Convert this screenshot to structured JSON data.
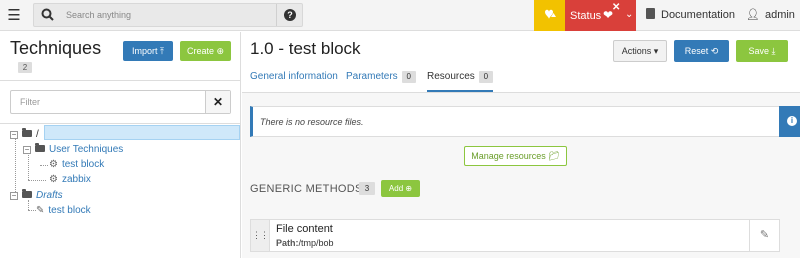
{
  "topbar": {
    "search_placeholder": "Search anything",
    "status_label": "Status",
    "documentation_label": "Documentation",
    "user_label": "admin",
    "colors": {
      "warning": "#f2c200",
      "status": "#d9403a"
    }
  },
  "left": {
    "title": "Techniques",
    "count": "2",
    "import_label": "Import",
    "create_label": "Create",
    "filter_placeholder": "Filter",
    "tree": {
      "root": "/",
      "category": "User Techniques",
      "items": [
        "test block",
        "zabbix"
      ],
      "drafts_label": "Drafts",
      "draft_items": [
        "test block"
      ]
    }
  },
  "main": {
    "title": "1.0 - test block",
    "actions_label": "Actions",
    "reset_label": "Reset",
    "save_label": "Save",
    "tabs": [
      {
        "label": "General information"
      },
      {
        "label": "Parameters",
        "count": "0"
      },
      {
        "label": "Resources",
        "count": "0"
      }
    ],
    "info_text": "There is no resource files.",
    "manage_resources_label": "Manage resources",
    "generic_methods_label": "GENERIC METHODS",
    "generic_methods_count": "3",
    "add_label": "Add",
    "method": {
      "name": "File content",
      "param_label": "Path:",
      "param_value": "/tmp/bob"
    }
  }
}
